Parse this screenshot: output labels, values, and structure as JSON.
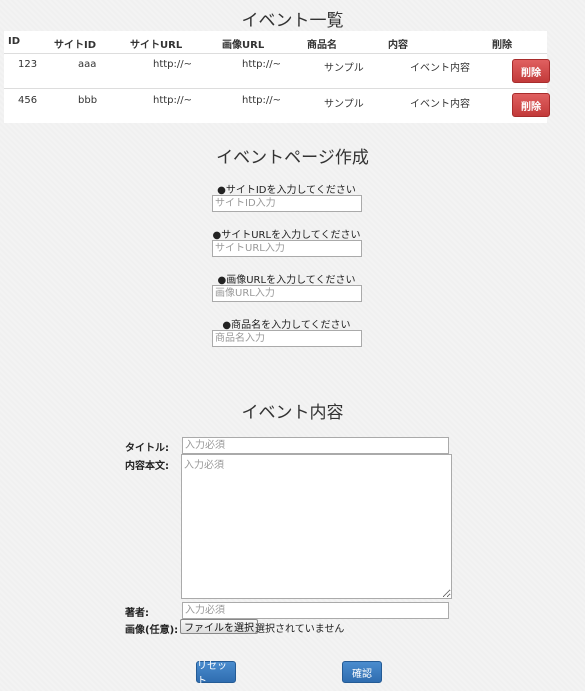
{
  "list": {
    "title": "イベント一覧",
    "headers": [
      "ID",
      "サイトID",
      "サイトURL",
      "画像URL",
      "商品名",
      "内容",
      "削除"
    ],
    "rows": [
      {
        "id": "123",
        "site_id": "aaa",
        "site_url": "http://~",
        "image_url": "http://~",
        "product": "サンプル",
        "content": "イベント内容",
        "delete": "削除"
      },
      {
        "id": "456",
        "site_id": "bbb",
        "site_url": "http://~",
        "image_url": "http://~",
        "product": "サンプル",
        "content": "イベント内容",
        "delete": "削除"
      }
    ]
  },
  "create": {
    "title": "イベントページ作成",
    "site_id_label": "●サイトIDを入力してください",
    "site_id_placeholder": "サイトID入力",
    "site_url_label": "●サイトURLを入力してください",
    "site_url_placeholder": "サイトURL入力",
    "image_url_label": "●画像URLを入力してください",
    "image_url_placeholder": "画像URL入力",
    "product_label": "●商品名を入力してください",
    "product_placeholder": "商品名入力"
  },
  "event": {
    "title": "イベント内容",
    "title_label": "タイトル:",
    "title_placeholder": "入力必須",
    "body_label": "内容本文:",
    "body_placeholder": "入力必須",
    "author_label": "著者:",
    "author_placeholder": "入力必須",
    "image_label": "画像(任意):",
    "file_button": "ファイルを選択",
    "file_status": "選択されていません"
  },
  "actions": {
    "reset": "リセット",
    "confirm": "確認"
  }
}
